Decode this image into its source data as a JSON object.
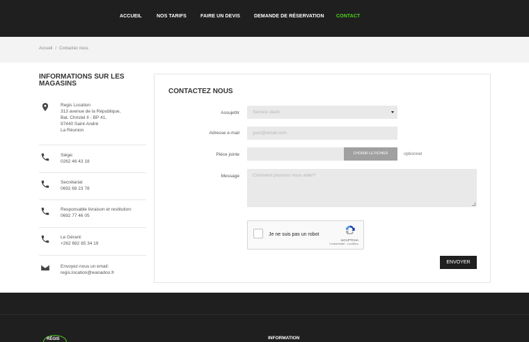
{
  "nav": {
    "items": [
      {
        "label": "ACCUEIL"
      },
      {
        "label": "NOS TARIFS"
      },
      {
        "label": "FAIRE UN DEVIS"
      },
      {
        "label": "DEMANDE DE RÉSERVATION"
      },
      {
        "label": "CONTACT"
      }
    ],
    "active_color": "#4fd21f"
  },
  "breadcrumb": {
    "home": "Accueil",
    "separator": "/",
    "current": "Contactez nous"
  },
  "sidebar": {
    "title": "INFORMATIONS SUR LES MAGASINS",
    "items": [
      {
        "icon": "location-pin-icon",
        "lines": [
          "Regis Location",
          "313 avenue de la République,",
          "Bat. Christel II - BP 41,",
          "97440 Saint-André",
          "La Réunion"
        ]
      },
      {
        "icon": "phone-icon",
        "lines": [
          "Siège:",
          "0262 46 43 18"
        ]
      },
      {
        "icon": "phone-icon",
        "lines": [
          "Secrétariat",
          "0692 69 23 78"
        ]
      },
      {
        "icon": "phone-icon",
        "lines": [
          "Responsable livraison et restitution:",
          "0692 77 46 05"
        ]
      },
      {
        "icon": "phone-icon",
        "lines": [
          "Le Gérant:",
          "+262 692 85 34 19"
        ]
      },
      {
        "icon": "envelope-icon",
        "lines": [
          "Envoyez-nous un email:",
          "regis.location@wanadoo.fr"
        ]
      }
    ]
  },
  "form": {
    "title": "CONTACTEZ NOUS",
    "subject_label": "Assujettir",
    "subject_value": "Service client",
    "email_label": "Adresse e-mail",
    "email_placeholder": "your@email.com",
    "attachment_label": "Pièce jointe",
    "attachment_button": "CHOISIR LE FICHIER",
    "attachment_optional": "optionnel",
    "message_label": "Message",
    "message_placeholder": "Comment pouvons nous aider?",
    "captcha_label": "Je ne suis pas un robot",
    "captcha_brand": "reCAPTCHA",
    "captcha_links": "Confidentialité - Conditions",
    "submit_label": "ENVOYER"
  },
  "footer": {
    "logo_text": "RÉGIS",
    "section_title": "INFORMATION"
  }
}
